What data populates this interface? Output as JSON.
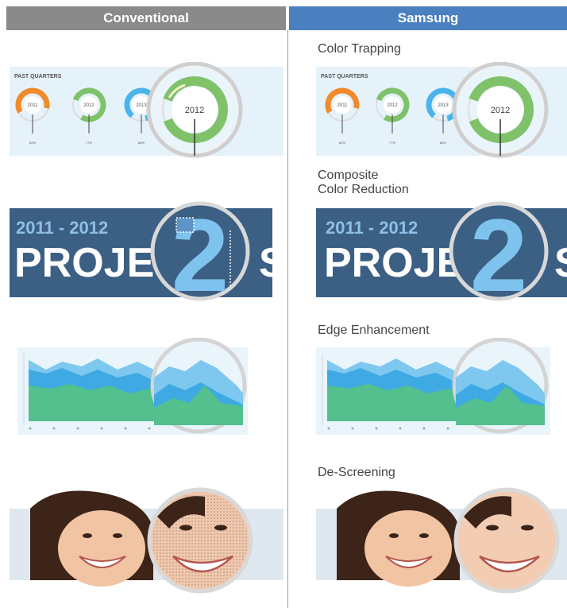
{
  "header": {
    "left_label": "Conventional",
    "right_label": "Samsung"
  },
  "rows": [
    {
      "label_lines": [
        "Color Trapping"
      ],
      "past_quarters_title": "PAST QUARTERS",
      "ring_years": [
        "2011",
        "2012",
        "2013"
      ],
      "ring_stats": [
        "62%",
        "77%",
        "86%"
      ],
      "zoom_year": "2012"
    },
    {
      "label_lines": [
        "Composite",
        "Color Reduction"
      ],
      "banner_years": "2011 - 2012",
      "banner_word": "PROJEC",
      "banner_tail": "S",
      "zoom_glyph": "2"
    },
    {
      "label_lines": [
        "Edge Enhancement"
      ]
    },
    {
      "label_lines": [
        "De-Screening"
      ]
    }
  ],
  "colors": {
    "header_left": "#8a8a8a",
    "header_right": "#4a7fc0",
    "banner_bg": "#3c5f84",
    "accent_blue": "#7ec3ee",
    "ring_orange": "#f08a2c",
    "ring_green": "#7fc26a",
    "ring_blue": "#4ab4ea"
  }
}
